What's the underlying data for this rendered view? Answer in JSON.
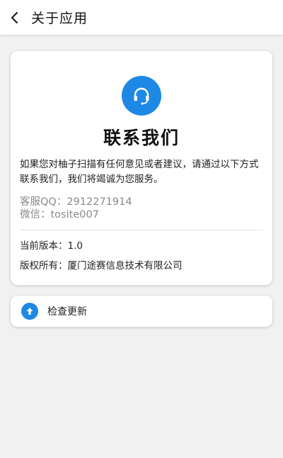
{
  "header": {
    "title": "关于应用",
    "back_icon": "chevron-left-icon"
  },
  "contact": {
    "icon": "headset-icon",
    "title": "联系我们",
    "description": "如果您对柚子扫描有任何意见或者建议，请通过以下方式联系我们，我们将竭诚为您服务。",
    "qq_label": "客服QQ：",
    "qq_value": "2912271914",
    "wechat_label": "微信：",
    "wechat_value": "tosite007"
  },
  "meta": {
    "version_label": "当前版本：",
    "version_value": "1.0",
    "copyright_label": "版权所有：",
    "copyright_value": "厦门途赛信息技术有限公司"
  },
  "update": {
    "icon": "arrow-up-icon",
    "label": "检查更新"
  },
  "colors": {
    "accent": "#1e88e5",
    "background": "#f1f1f1",
    "muted_text": "#8a8a8a"
  }
}
